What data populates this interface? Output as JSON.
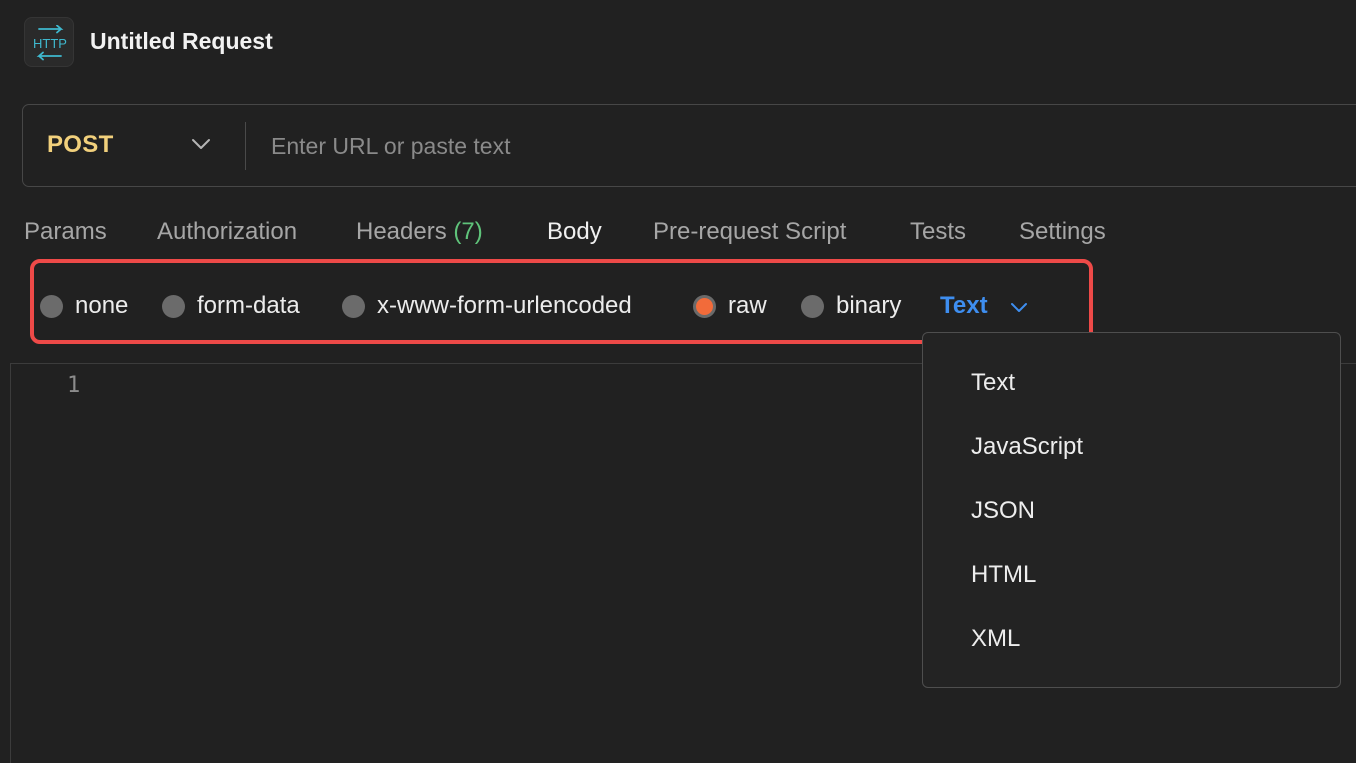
{
  "header": {
    "icon": "http-icon",
    "icon_text": "HTTP",
    "title": "Untitled Request"
  },
  "url_bar": {
    "method": "POST",
    "placeholder": "Enter URL or paste text",
    "value": ""
  },
  "tabs": [
    {
      "label": "Params"
    },
    {
      "label": "Authorization"
    },
    {
      "label": "Headers",
      "count": "(7)"
    },
    {
      "label": "Body",
      "active": true
    },
    {
      "label": "Pre-request Script"
    },
    {
      "label": "Tests"
    },
    {
      "label": "Settings"
    }
  ],
  "body_types": [
    {
      "label": "none",
      "checked": false
    },
    {
      "label": "form-data",
      "checked": false
    },
    {
      "label": "x-www-form-urlencoded",
      "checked": false
    },
    {
      "label": "raw",
      "checked": true
    },
    {
      "label": "binary",
      "checked": false
    }
  ],
  "language": {
    "selected": "Text",
    "options": [
      "Text",
      "JavaScript",
      "JSON",
      "HTML",
      "XML"
    ]
  },
  "editor": {
    "line_numbers": [
      "1"
    ]
  },
  "colors": {
    "background": "#212121",
    "method": "#f1d07c",
    "headers_count": "#5fc37a",
    "radio_checked": "#f26b3a",
    "language_accent": "#3e8ef0",
    "highlight_border": "#ee4a48"
  }
}
